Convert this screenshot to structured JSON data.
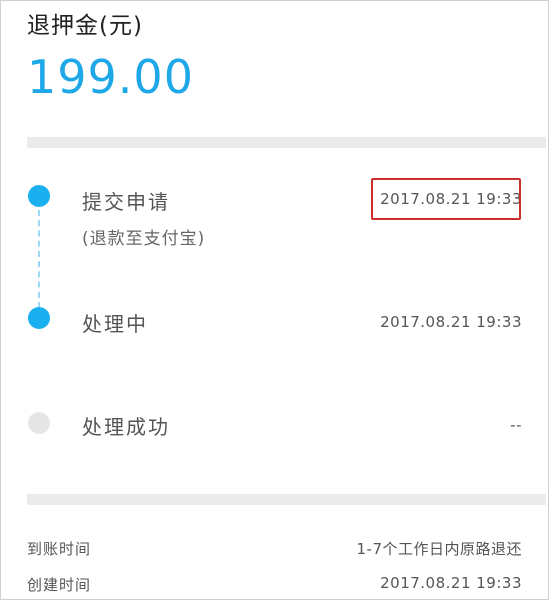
{
  "header": {
    "deposit_label": "退押金(元)",
    "deposit_amount": "199.00"
  },
  "timeline": {
    "steps": [
      {
        "title": "提交申请",
        "subtitle": "(退款至支付宝)",
        "time": "2017.08.21 19:33",
        "status": "done",
        "highlighted": true
      },
      {
        "title": "处理中",
        "time": "2017.08.21 19:33",
        "status": "done"
      },
      {
        "title": "处理成功",
        "time": "--",
        "status": "pending"
      }
    ]
  },
  "info": {
    "arrival_label": "到账时间",
    "arrival_value": "1-7个工作日内原路退还",
    "created_label": "创建时间",
    "created_value": "2017.08.21 19:33"
  },
  "colors": {
    "accent": "#1ab0f0",
    "amount": "#1fa8e8",
    "inactive_dot": "#e6e6e6",
    "highlight_border": "#c9302c",
    "band": "#ebebeb"
  }
}
